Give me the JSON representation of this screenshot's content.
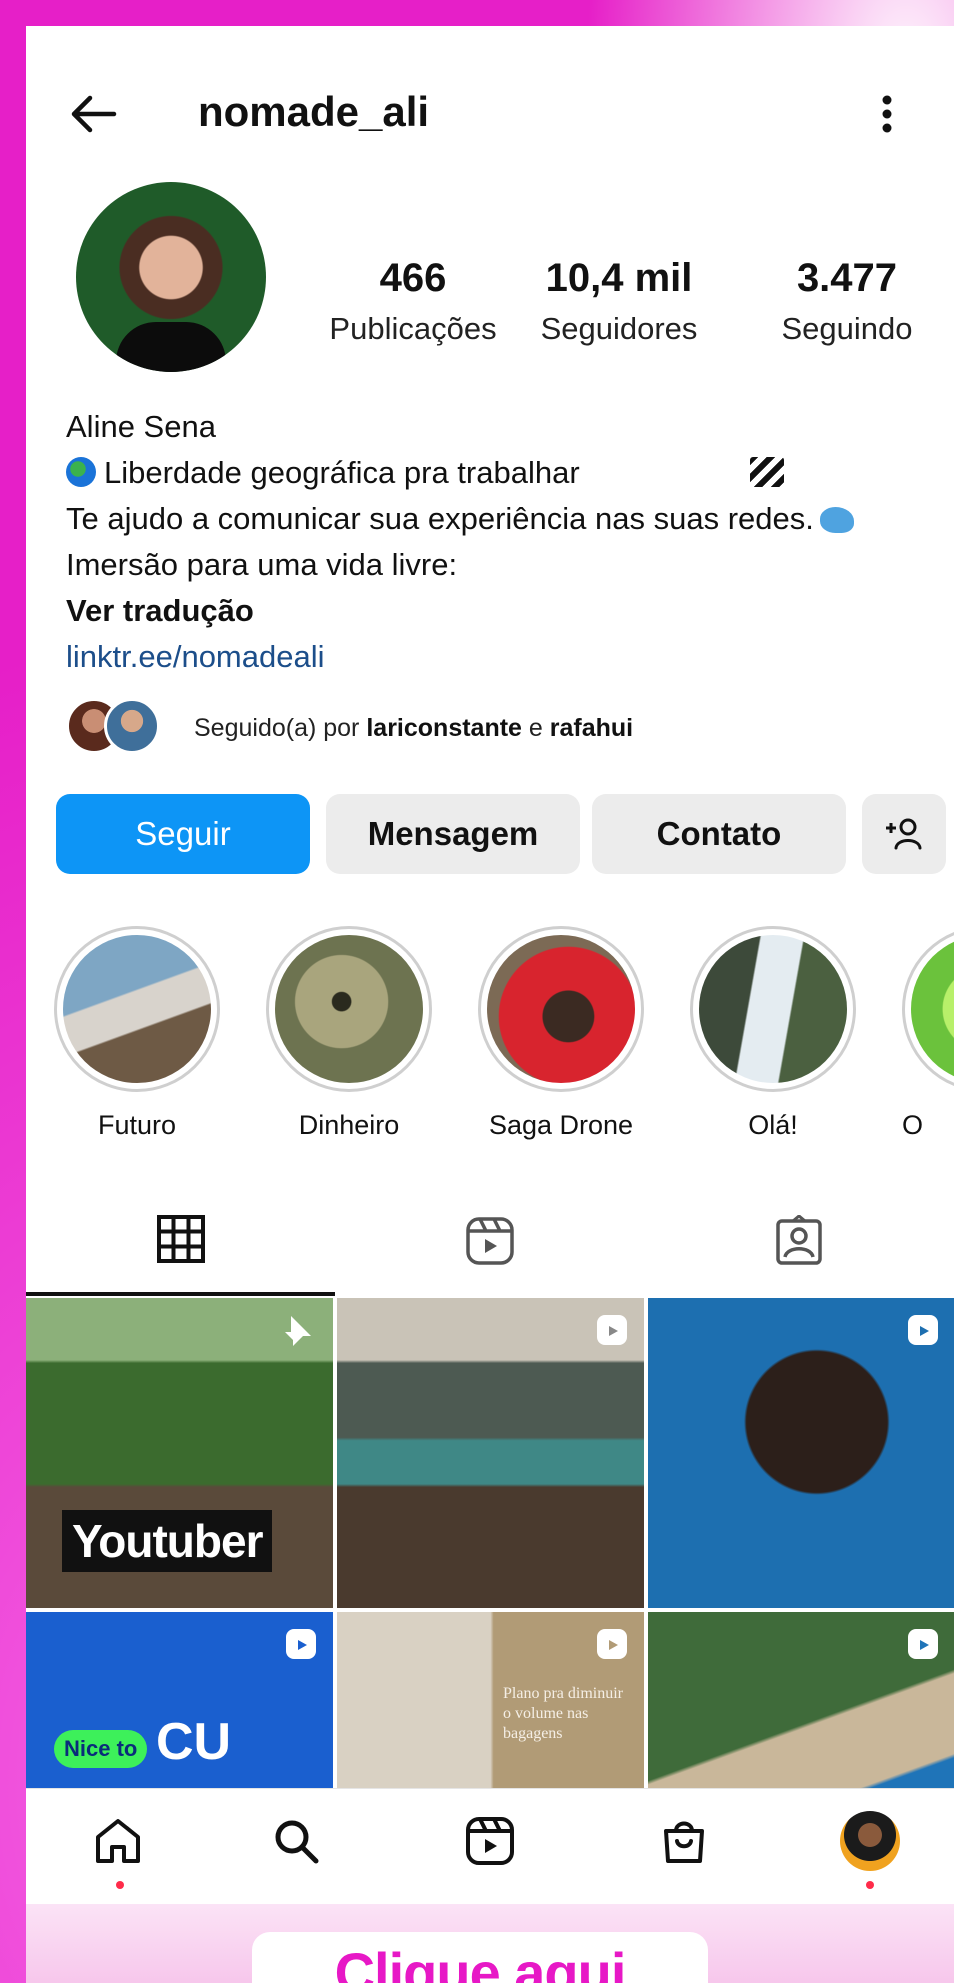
{
  "header": {
    "username": "nomade_ali"
  },
  "stats": {
    "posts": {
      "value": "466",
      "label": "Publicações"
    },
    "followers": {
      "value": "10,4 mil",
      "label": "Seguidores"
    },
    "following": {
      "value": "3.477",
      "label": "Seguindo"
    }
  },
  "bio": {
    "name": "Aline Sena",
    "line1": "Liberdade geográfica pra trabalhar",
    "line2": "Te ajudo a comunicar sua experiência nas suas redes.",
    "line3": "Imersão para uma vida livre:",
    "translate": "Ver tradução",
    "link": "linktr.ee/nomadeali"
  },
  "followed_by": {
    "prefix": "Seguido(a) por",
    "user1": "lariconstante",
    "conjunction": "e",
    "user2": "rafahui"
  },
  "actions": {
    "follow": "Seguir",
    "message": "Mensagem",
    "contact": "Contato"
  },
  "highlights": [
    {
      "label": "Futuro"
    },
    {
      "label": "Dinheiro"
    },
    {
      "label": "Saga Drone"
    },
    {
      "label": "Olá!"
    },
    {
      "label": "O"
    }
  ],
  "posts": {
    "p1_text": "Youtuber",
    "p4_tag": "Nice to",
    "p4_big": "CU",
    "p5_text": "Plano pra diminuir o volume nas bagagens"
  },
  "cta": {
    "label": "Clique aqui"
  },
  "colors": {
    "background": "#e61fc8",
    "follow_button": "#0d95f6",
    "cta_text": "#e718c6",
    "link": "#1c4e8a"
  }
}
